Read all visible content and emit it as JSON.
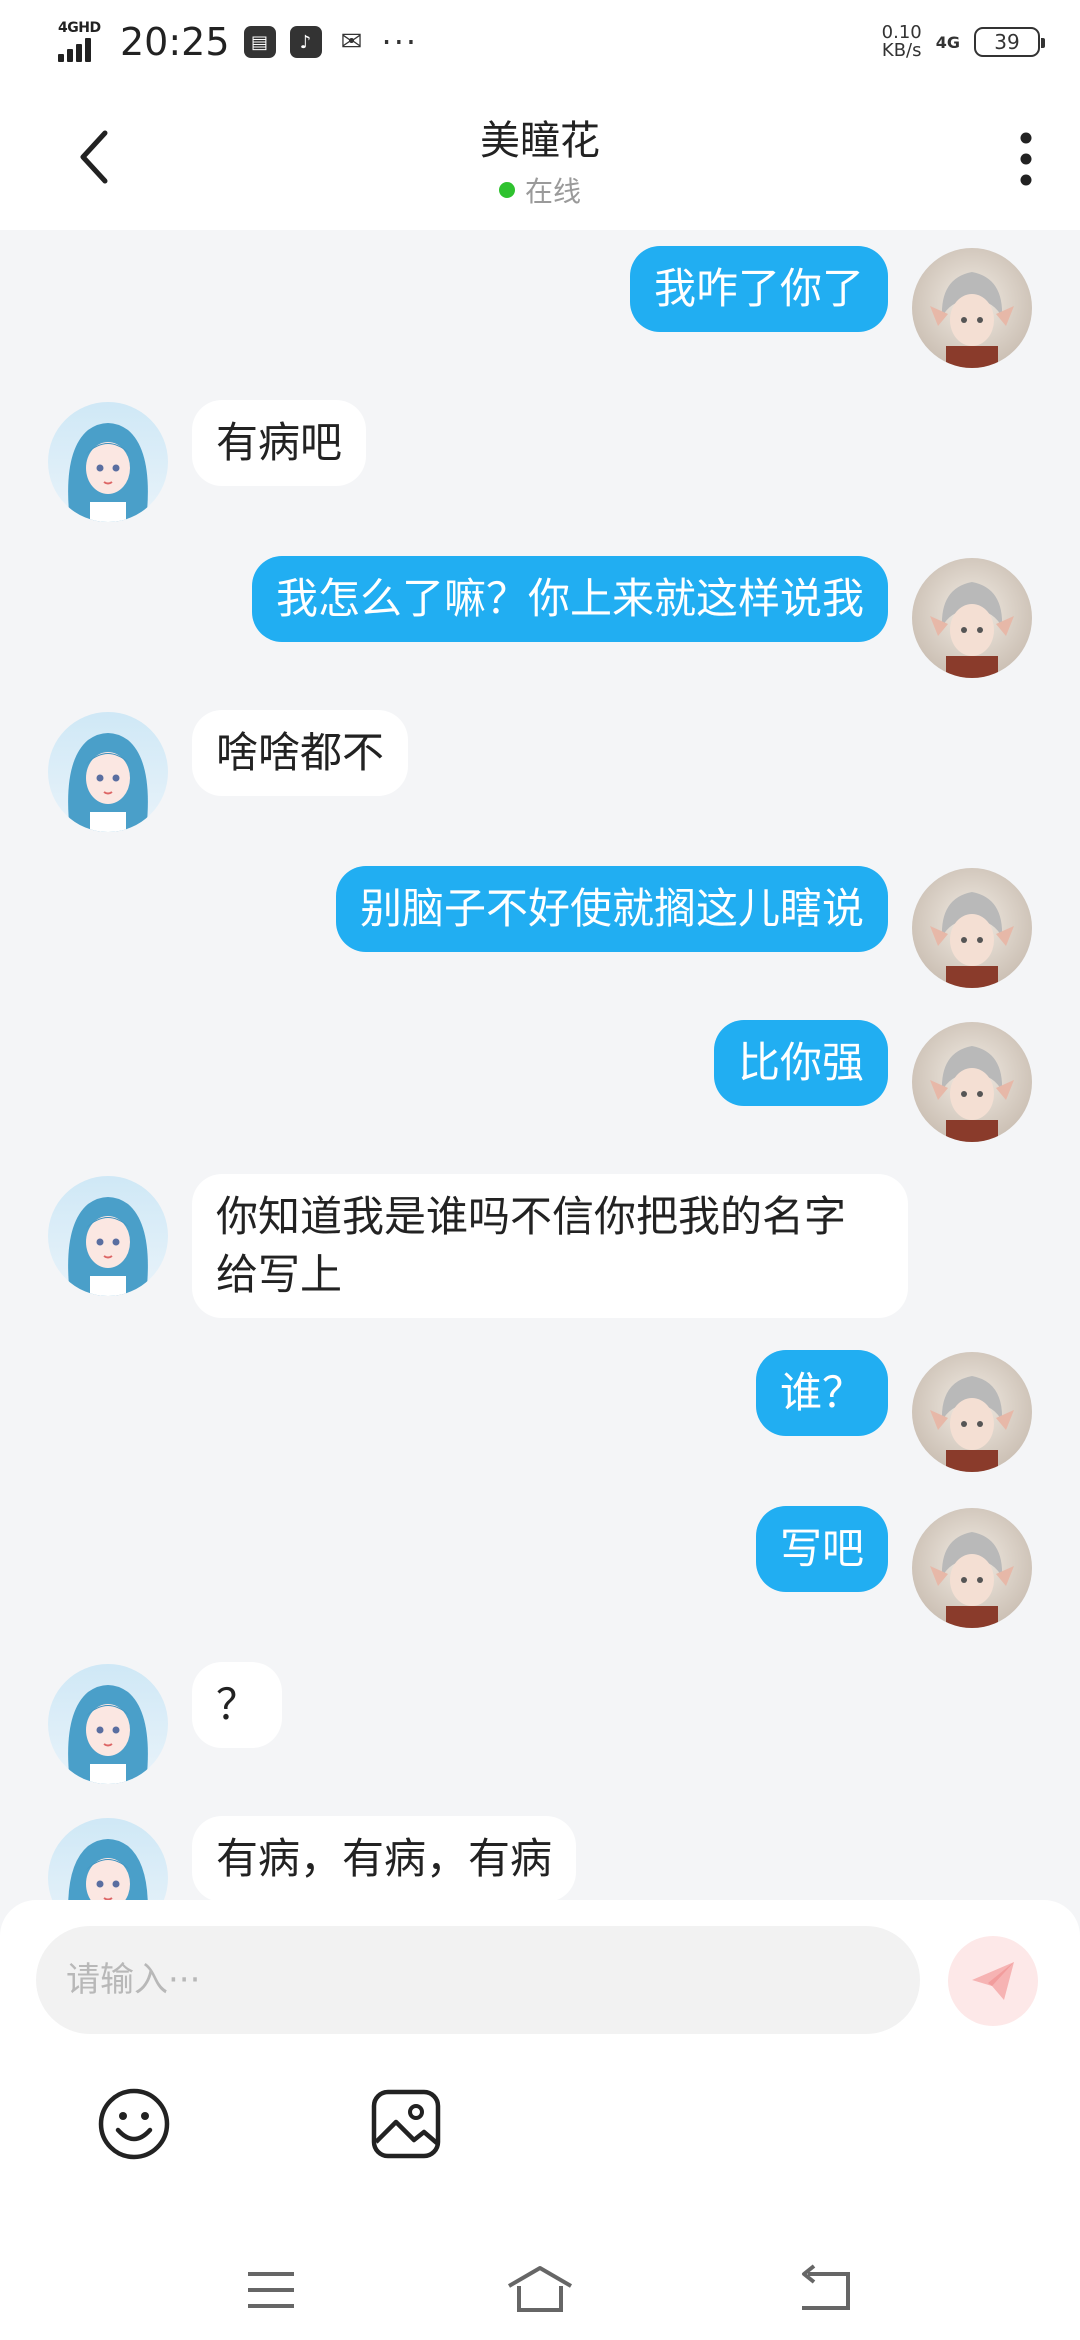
{
  "status_bar": {
    "network": "4GHD",
    "time": "20:25",
    "more": "···",
    "speed_value": "0.10",
    "speed_unit": "KB/s",
    "network_right": "4G",
    "battery": "39"
  },
  "header": {
    "title": "美瞳花",
    "status": "在线"
  },
  "messages": [
    {
      "from": "self",
      "text": "我咋了你了"
    },
    {
      "from": "other",
      "text": "有病吧"
    },
    {
      "from": "self",
      "text": "我怎么了嘛？你上来就这样说我"
    },
    {
      "from": "other",
      "text": "啥啥都不"
    },
    {
      "from": "self",
      "text": "别脑子不好使就搁这儿瞎说"
    },
    {
      "from": "self",
      "text": "比你强"
    },
    {
      "from": "other",
      "text": "你知道我是谁吗不信你把我的名字给写上"
    },
    {
      "from": "self",
      "text": "谁？"
    },
    {
      "from": "self",
      "text": "写吧"
    },
    {
      "from": "other",
      "text": "？"
    },
    {
      "from": "other",
      "text": "有病，有病，有病"
    }
  ],
  "input": {
    "placeholder": "请输入···"
  },
  "colors": {
    "self_bubble": "#21aef2",
    "other_bubble": "#ffffff",
    "online": "#2fc22f",
    "send_button_bg": "#fde8e8"
  },
  "icons": {
    "back": "chevron-left-icon",
    "more": "vertical-dots-icon",
    "send": "paper-plane-icon",
    "emoji": "smiley-icon",
    "image": "image-icon",
    "nav_menu": "menu-icon",
    "nav_home": "home-icon",
    "nav_back": "return-icon"
  }
}
